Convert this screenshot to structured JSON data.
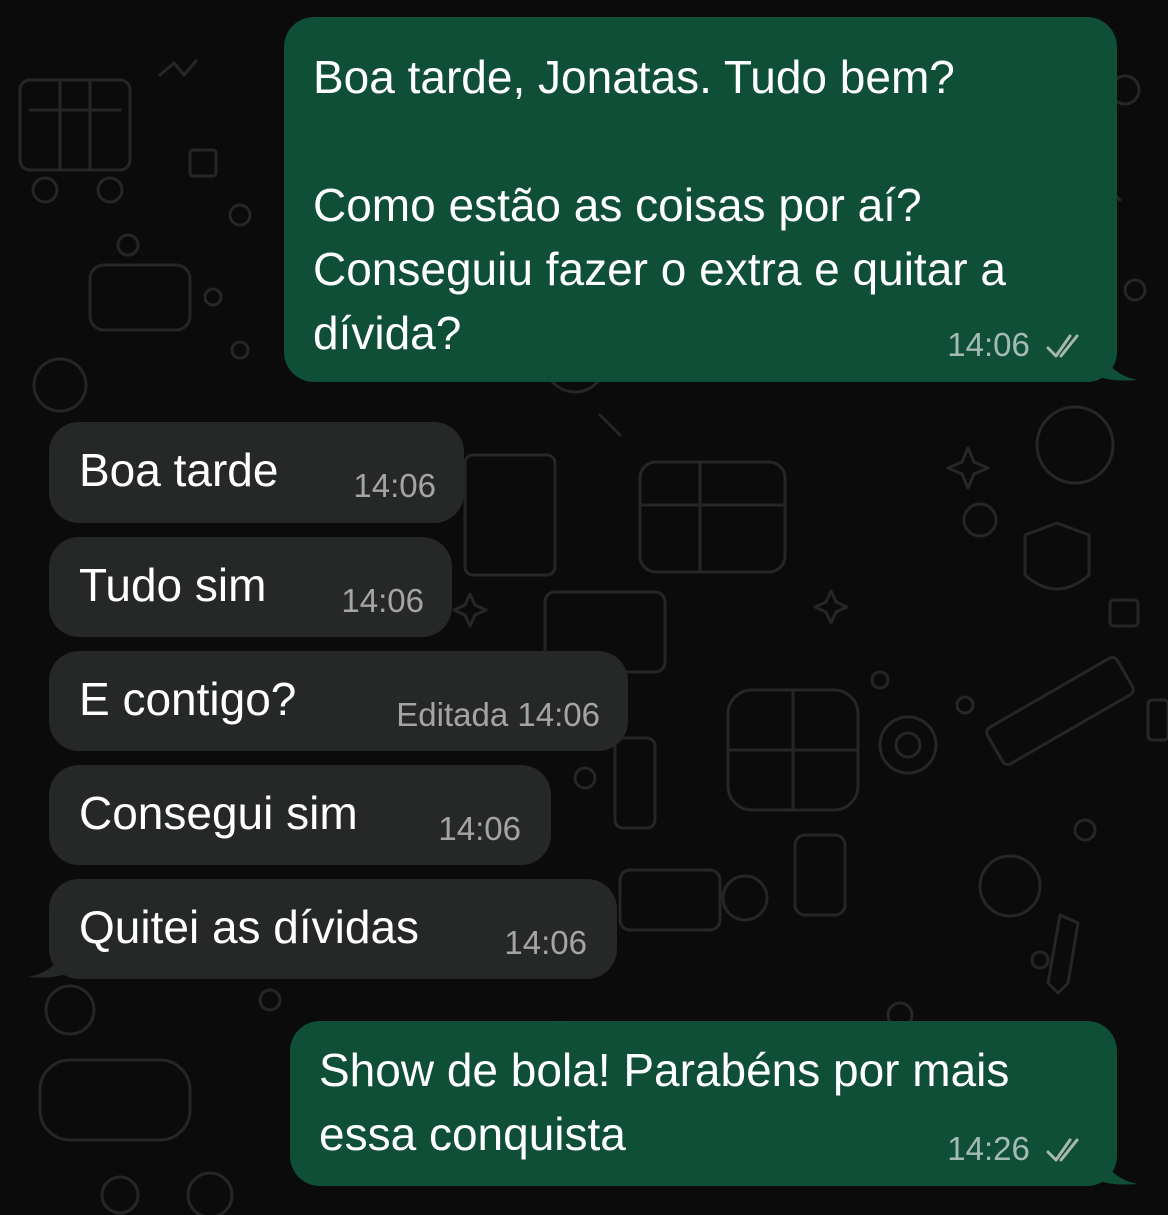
{
  "colors": {
    "background": "#0b0b0b",
    "outgoing_bubble": "#0f4e37",
    "incoming_bubble": "#262727",
    "text": "#ffffff",
    "meta": "#9fb3aa"
  },
  "messages": [
    {
      "direction": "outgoing",
      "text": "Boa tarde, Jonatas. Tudo bem?\n\nComo estão as coisas por aí? Conseguiu fazer o extra e quitar a dívida?",
      "time": "14:06",
      "status_icon": "double-check-icon"
    },
    {
      "direction": "incoming",
      "text": "Boa tarde",
      "time": "14:06"
    },
    {
      "direction": "incoming",
      "text": "Tudo sim",
      "time": "14:06"
    },
    {
      "direction": "incoming",
      "text": "E contigo?",
      "edited_label": "Editada",
      "time": "14:06"
    },
    {
      "direction": "incoming",
      "text": "Consegui sim",
      "time": "14:06"
    },
    {
      "direction": "incoming",
      "text": "Quitei as dívidas",
      "time": "14:06"
    },
    {
      "direction": "outgoing",
      "text": "Show de bola! Parabéns por mais essa conquista",
      "time": "14:26",
      "status_icon": "double-check-icon"
    }
  ]
}
